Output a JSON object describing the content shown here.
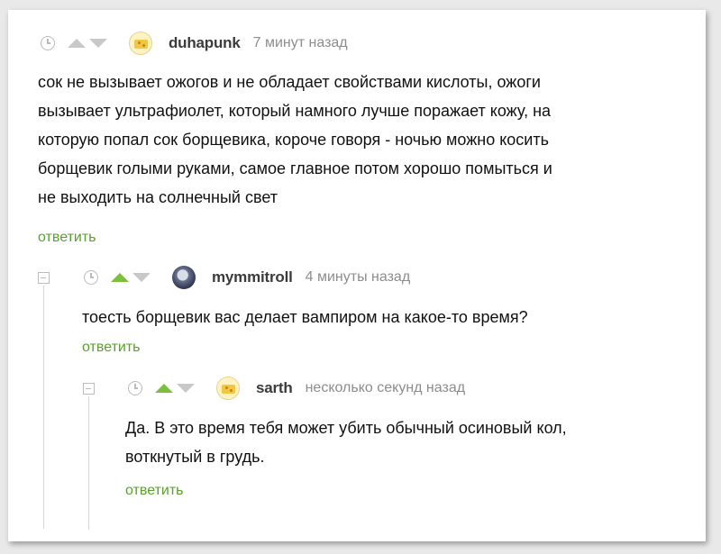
{
  "comments": [
    {
      "username": "duhapunk",
      "time": "7 минут назад",
      "lines": [
        "сок не вызывает ожогов и не обладает свойствами кислоты, ожоги",
        "вызывает ультрафиолет, который намного лучше поражает кожу, на",
        "которую попал сок борщевика, короче говоря - ночью можно косить",
        "борщевик голыми руками, самое главное потом хорошо помыться и",
        "не выходить на солнечный свет"
      ],
      "reply_label": "ответить",
      "avatar_icon": "cheese-avatar-icon",
      "upvoted": false
    },
    {
      "username": "mymmitroll",
      "time": "4 минуты назад",
      "lines": [
        "тоесть борщевик вас делает вампиром на какое-то время?"
      ],
      "reply_label": "ответить",
      "avatar_icon": "photo-avatar-icon",
      "upvoted": true
    },
    {
      "username": "sarth",
      "time": "несколько секунд назад",
      "lines": [
        "Да. В это время тебя может убить обычный осиновый кол,",
        "воткнутый в грудь."
      ],
      "reply_label": "ответить",
      "avatar_icon": "cheese-avatar-icon",
      "upvoted": true
    }
  ],
  "colors": {
    "reply_link": "#5aa02c",
    "upvote_active": "#7cbf3a",
    "vote_inactive": "#c8c8c8"
  }
}
